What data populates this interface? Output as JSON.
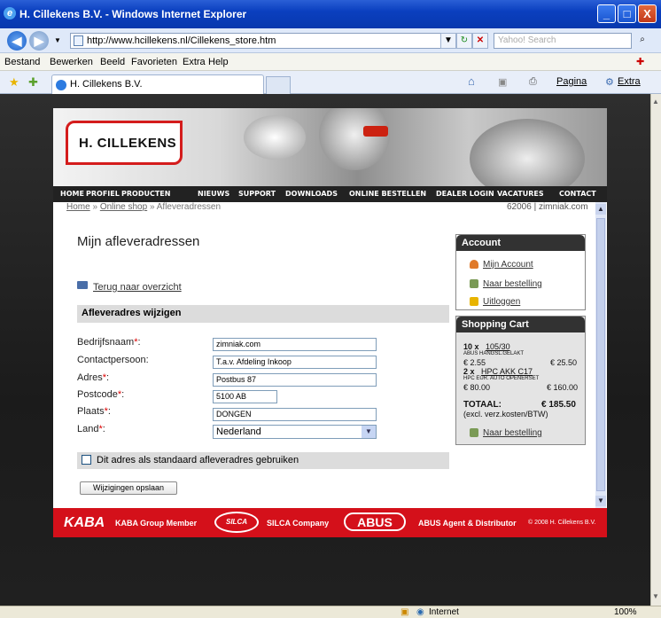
{
  "window": {
    "title": "H. Cillekens B.V. - Windows Internet Explorer",
    "min": "_",
    "max": "□",
    "close": "X"
  },
  "address": {
    "url": "http://www.hcillekens.nl/Cillekens_store.htm",
    "search_placeholder": "Yahoo! Search"
  },
  "menu": [
    "Bestand",
    "Bewerken",
    "Beeld",
    "Favorieten",
    "Extra",
    "Help"
  ],
  "tab": {
    "title": "H. Cillekens B.V."
  },
  "toolbar_right": {
    "page": "Pagina",
    "extra": "Extra"
  },
  "site": {
    "logo": "H. CILLEKENS",
    "nav": [
      "HOME",
      "PROFIEL",
      "PRODUCTEN",
      "NIEUWS",
      "SUPPORT",
      "DOWNLOADS",
      "ONLINE BESTELLEN",
      "DEALER LOGIN",
      "VACATURES",
      "CONTACT"
    ],
    "breadcrumb": {
      "home": "Home",
      "shop": "Online shop",
      "current": "Afleveradressen",
      "sep": "»"
    },
    "user_info": "62006 | zimniak.com"
  },
  "main": {
    "title": "Mijn afleveradressen",
    "back_link": "Terug naar overzicht",
    "section_title": "Afleveradres wijzigen",
    "fields": [
      {
        "label": "Bedrijfsnaam",
        "required": "*",
        "value": "zimniak.com"
      },
      {
        "label": "Contactpersoon",
        "required": "",
        "value": "T.a.v. Afdeling Inkoop"
      },
      {
        "label": "Adres",
        "required": "*",
        "value": "Postbus 87"
      },
      {
        "label": "Postcode",
        "required": "*",
        "value": "5100 AB"
      },
      {
        "label": "Plaats",
        "required": "*",
        "value": "DONGEN"
      },
      {
        "label": "Land",
        "required": "*",
        "value": "Nederland"
      }
    ],
    "default_checkbox_label": "Dit adres als standaard afleveradres gebruiken",
    "save_button": "Wijzigingen opslaan"
  },
  "account": {
    "title": "Account",
    "items": [
      "Mijn Account",
      "Naar bestelling",
      "Uitloggen"
    ]
  },
  "cart": {
    "title": "Shopping Cart",
    "items": [
      {
        "qty": "10 x",
        "code": "105/30",
        "desc": "ABUS HANGSL.GELAKT",
        "unit": "€ 2.55",
        "total": "€ 25.50"
      },
      {
        "qty": "2 x",
        "code": "HPC AKK C17",
        "desc": "HPC EUR. AUTO OPENERSET",
        "unit": "€ 80.00",
        "total": "€ 160.00"
      }
    ],
    "total_label": "TOTAAL:",
    "total_value": "€ 185.50",
    "note": "(excl. verz.kosten/BTW)",
    "order_link": "Naar bestelling"
  },
  "footer": {
    "kaba_logo": "KABA",
    "kaba": "KABA Group Member",
    "silca_logo": "SILCA",
    "silca": "SILCA Company",
    "abus_logo": "ABUS",
    "abus": "ABUS Agent & Distributor",
    "copyright": "© 2008 H. Cillekens B.V."
  },
  "status": {
    "zone": "Internet",
    "zoom": "100%"
  },
  "colors": {
    "brand_red": "#d41c1c",
    "nav_dark": "#222222",
    "ie_blue": "#0a3fbf"
  }
}
